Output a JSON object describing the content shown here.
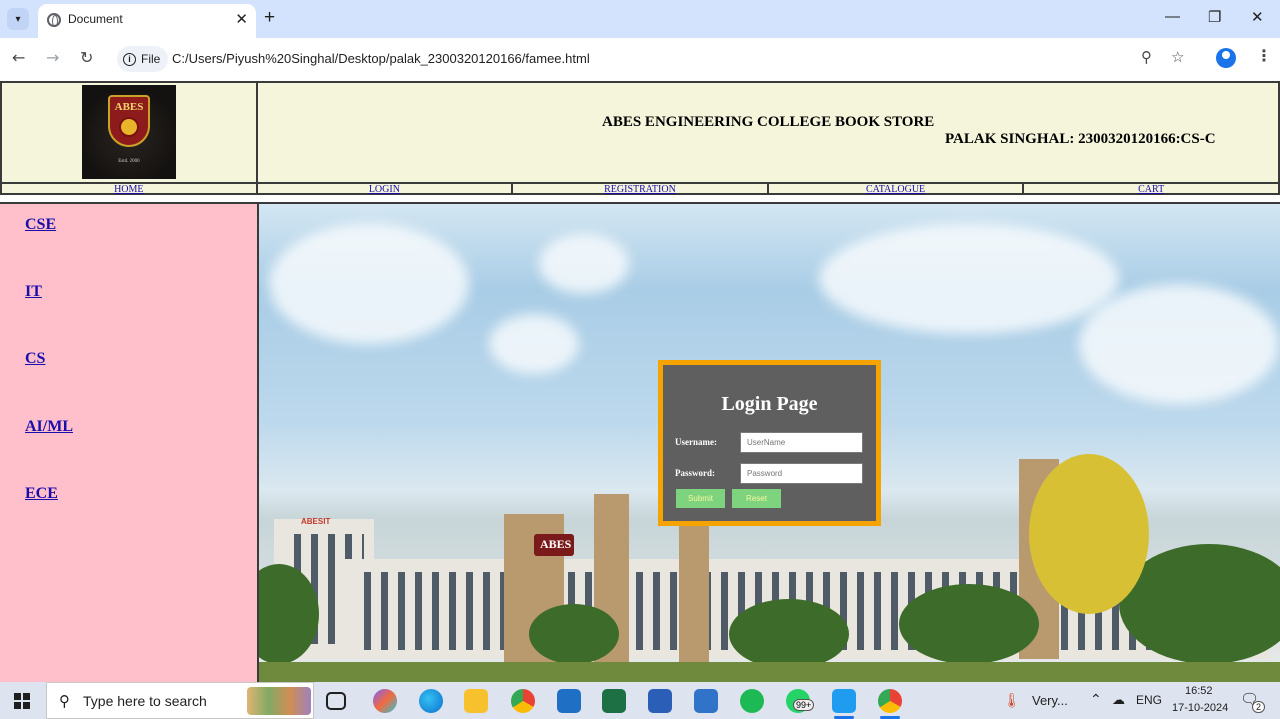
{
  "browser": {
    "tab_title": "Document",
    "new_tab": "+",
    "address_chip": "File",
    "url": "C:/Users/Piyush%20Singhal/Desktop/palak_2300320120166/famee.html",
    "controls": {
      "minimize": "—",
      "maximize": "❐",
      "close": "✕",
      "tab_close": "✕"
    }
  },
  "header": {
    "logo_text": "ABES",
    "logo_est": "Estd. 2000",
    "store_title": "ABES ENGINEERING COLLEGE BOOK STORE",
    "student": "PALAK SINGHAL: 2300320120166:CS-C"
  },
  "nav": [
    {
      "label": "HOME"
    },
    {
      "label": "LOGIN"
    },
    {
      "label": "REGISTRATION"
    },
    {
      "label": "CATALOGUE"
    },
    {
      "label": "CART"
    }
  ],
  "sidebar": [
    {
      "label": "CSE"
    },
    {
      "label": "IT"
    },
    {
      "label": "CS"
    },
    {
      "label": "AI/ML"
    },
    {
      "label": "ECE"
    }
  ],
  "hero": {
    "building_sign": "ABES",
    "building_sign2": "ABESIT"
  },
  "login": {
    "title": "Login Page",
    "username_label": "Username:",
    "username_placeholder": "UserName",
    "password_label": "Password:",
    "password_placeholder": "Password",
    "submit_label": "Submit",
    "reset_label": "Reset",
    "colors": {
      "box": "#5f5f5f",
      "border": "#f5a300",
      "button": "#7ed47e"
    }
  },
  "taskbar": {
    "search_placeholder": "Type here to search",
    "notification_badge": "99+",
    "weather": "Very...",
    "language": "ENG",
    "time": "16:52",
    "date": "17-10-2024",
    "notification_count": "2"
  }
}
